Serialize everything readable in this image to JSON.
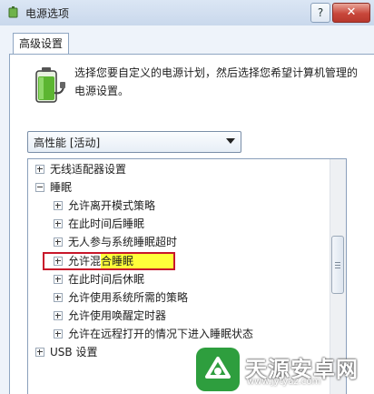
{
  "window": {
    "title": "电源选项",
    "help_label": "?",
    "close_label": "✕"
  },
  "tabs": [
    {
      "label": "高级设置"
    }
  ],
  "description": "选择您要自定义的电源计划，然后选择您希望计算机管理的电源设置。",
  "plan_select": {
    "value": "高性能 [活动]"
  },
  "tree": [
    {
      "label": "无线适配器设置",
      "expanded": false,
      "level": 0
    },
    {
      "label": "睡眠",
      "expanded": true,
      "level": 0
    },
    {
      "label": "允许离开模式策略",
      "expanded": false,
      "level": 1
    },
    {
      "label": "在此时间后睡眠",
      "expanded": false,
      "level": 1
    },
    {
      "label": "无人参与系统睡眠超时",
      "expanded": false,
      "level": 1
    },
    {
      "label": "允许混合睡眠",
      "expanded": false,
      "level": 1,
      "highlighted": true
    },
    {
      "label": "在此时间后休眠",
      "expanded": false,
      "level": 1
    },
    {
      "label": "允许使用系统所需的策略",
      "expanded": false,
      "level": 1
    },
    {
      "label": "允许使用唤醒定时器",
      "expanded": false,
      "level": 1
    },
    {
      "label": "允许在远程打开的情况下进入睡眠状态",
      "expanded": false,
      "level": 1
    },
    {
      "label": "USB 设置",
      "expanded": false,
      "level": 0
    }
  ],
  "watermark": {
    "text": "天源安卓网",
    "url": "www.jytyaz.com"
  },
  "colors": {
    "highlight_box": "#c8172b",
    "highlight_fill": "#ffff3a",
    "close_button": "#c8473b"
  }
}
